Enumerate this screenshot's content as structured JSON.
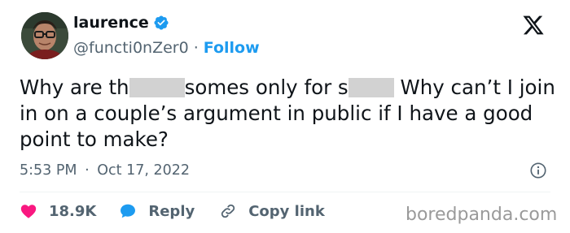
{
  "author": {
    "display_name": "laurence",
    "handle": "@functi0nZer0",
    "separator": "·",
    "follow_label": "Follow",
    "verified_icon": "verified-badge-icon",
    "verified_color": "#1d9bf0"
  },
  "platform_logo": "x-logo-icon",
  "tweet": {
    "part1": "Why are th",
    "part2": "somes only for s",
    "part3": " Why can’t I join in on a couple’s argument in public if I have a good point to make?"
  },
  "meta": {
    "time": "5:53 PM",
    "separator": "·",
    "date": "Oct 17, 2022",
    "info_icon": "info-icon"
  },
  "actions": {
    "like_count": "18.9K",
    "like_color": "#f91880",
    "reply_label": "Reply",
    "reply_color": "#1d9bf0",
    "copy_label": "Copy link"
  },
  "watermark": "boredpanda.com"
}
